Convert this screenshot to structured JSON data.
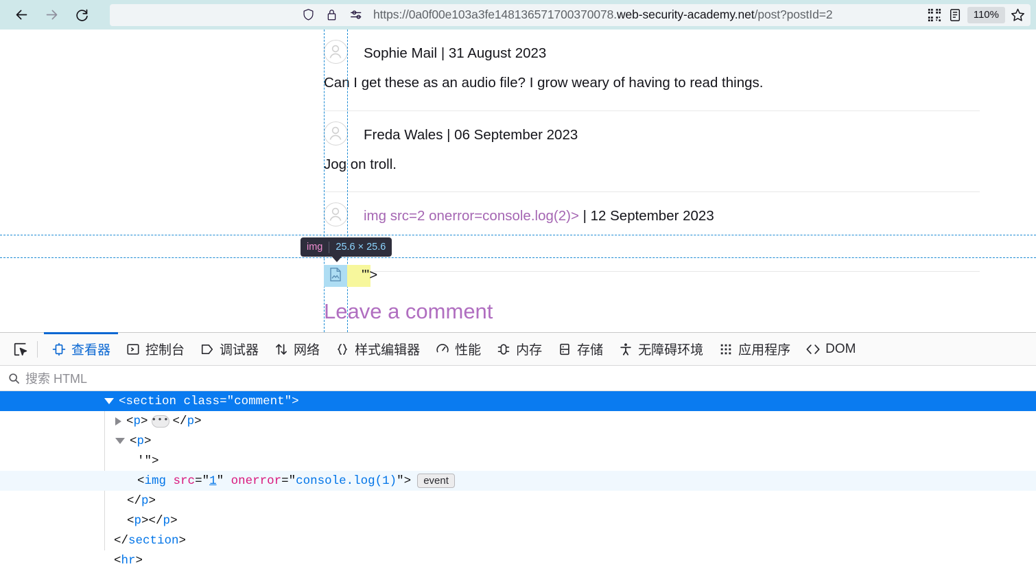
{
  "browser": {
    "nav": {
      "back_icon": "arrow-left-icon",
      "forward_icon": "arrow-right-icon",
      "reload_icon": "reload-icon"
    },
    "urlbar": {
      "shield_icon": "shield-icon",
      "lock_icon": "lock-icon",
      "permissions_icon": "permissions-icon",
      "url_prefix": "https://0a0f00e103a3fe148136571700370078.",
      "url_host": "web-security-academy.net",
      "url_path": "/post?postId=2",
      "full_url": "https://0a0f00e103a3fe148136571700370078.web-security-academy.net/post?postId=2",
      "qr_icon": "qr-code-icon",
      "reader_icon": "reader-mode-icon",
      "zoom_level": "110%",
      "bookmark_icon": "star-icon"
    }
  },
  "page": {
    "comments": [
      {
        "author": "Sophie Mail",
        "separator": " | ",
        "date": "31 August 2023",
        "body": "Can I get these as an audio file? I grow weary of having to read things."
      },
      {
        "author": "Freda Wales",
        "separator": " | ",
        "date": "06 September 2023",
        "body": "Jog on troll."
      },
      {
        "author": "img src=2 onerror=console.log(2)>",
        "separator": " | ",
        "date": "12 September 2023",
        "body": "'\">"
      }
    ],
    "leave_comment_heading": "Leave a comment"
  },
  "highlight": {
    "tooltip_tag": "img",
    "tooltip_dims": "25.6 × 25.6",
    "content_color": "#aeddf3",
    "margin_color": "#f7f79c",
    "guide_color": "#1a8ad4",
    "broken_image_icon": "broken-image-icon"
  },
  "devtools": {
    "picker_icon": "element-picker-icon",
    "tabs": [
      {
        "label": "查看器",
        "icon": "inspector-icon",
        "active": true
      },
      {
        "label": "控制台",
        "icon": "console-icon",
        "active": false
      },
      {
        "label": "调试器",
        "icon": "debugger-icon",
        "active": false
      },
      {
        "label": "网络",
        "icon": "network-icon",
        "active": false
      },
      {
        "label": "样式编辑器",
        "icon": "style-editor-icon",
        "active": false
      },
      {
        "label": "性能",
        "icon": "performance-icon",
        "active": false
      },
      {
        "label": "内存",
        "icon": "memory-icon",
        "active": false
      },
      {
        "label": "存储",
        "icon": "storage-icon",
        "active": false
      },
      {
        "label": "无障碍环境",
        "icon": "accessibility-icon",
        "active": false
      },
      {
        "label": "应用程序",
        "icon": "application-icon",
        "active": false
      },
      {
        "label": "DOM",
        "icon": "dom-icon",
        "active": false
      }
    ],
    "search": {
      "icon": "search-icon",
      "placeholder": "搜索 HTML",
      "value": ""
    },
    "dom_rows": [
      {
        "kind": "open",
        "twisty": "open",
        "indent": 152,
        "selected": true,
        "tag": "section",
        "attr_name": "class",
        "attr_value": "comment"
      },
      {
        "kind": "collapsed_p",
        "twisty": "closed",
        "indent": 168
      },
      {
        "kind": "open_plain",
        "twisty": "open",
        "indent": 168,
        "tag": "p"
      },
      {
        "kind": "text",
        "indent": 200,
        "text": "'\">"
      },
      {
        "kind": "img",
        "indent": 200,
        "hovered": true,
        "tag": "img",
        "attr1_name": "src",
        "attr1_value": "1",
        "attr2_name": "onerror",
        "attr2_value": "console.log(1)",
        "badge": "event"
      },
      {
        "kind": "close",
        "indent": 185,
        "tag": "p"
      },
      {
        "kind": "empty_pair",
        "indent": 185,
        "tag": "p"
      },
      {
        "kind": "close",
        "indent": 166,
        "tag": "section"
      },
      {
        "kind": "void",
        "indent": 166,
        "tag": "hr"
      }
    ]
  }
}
